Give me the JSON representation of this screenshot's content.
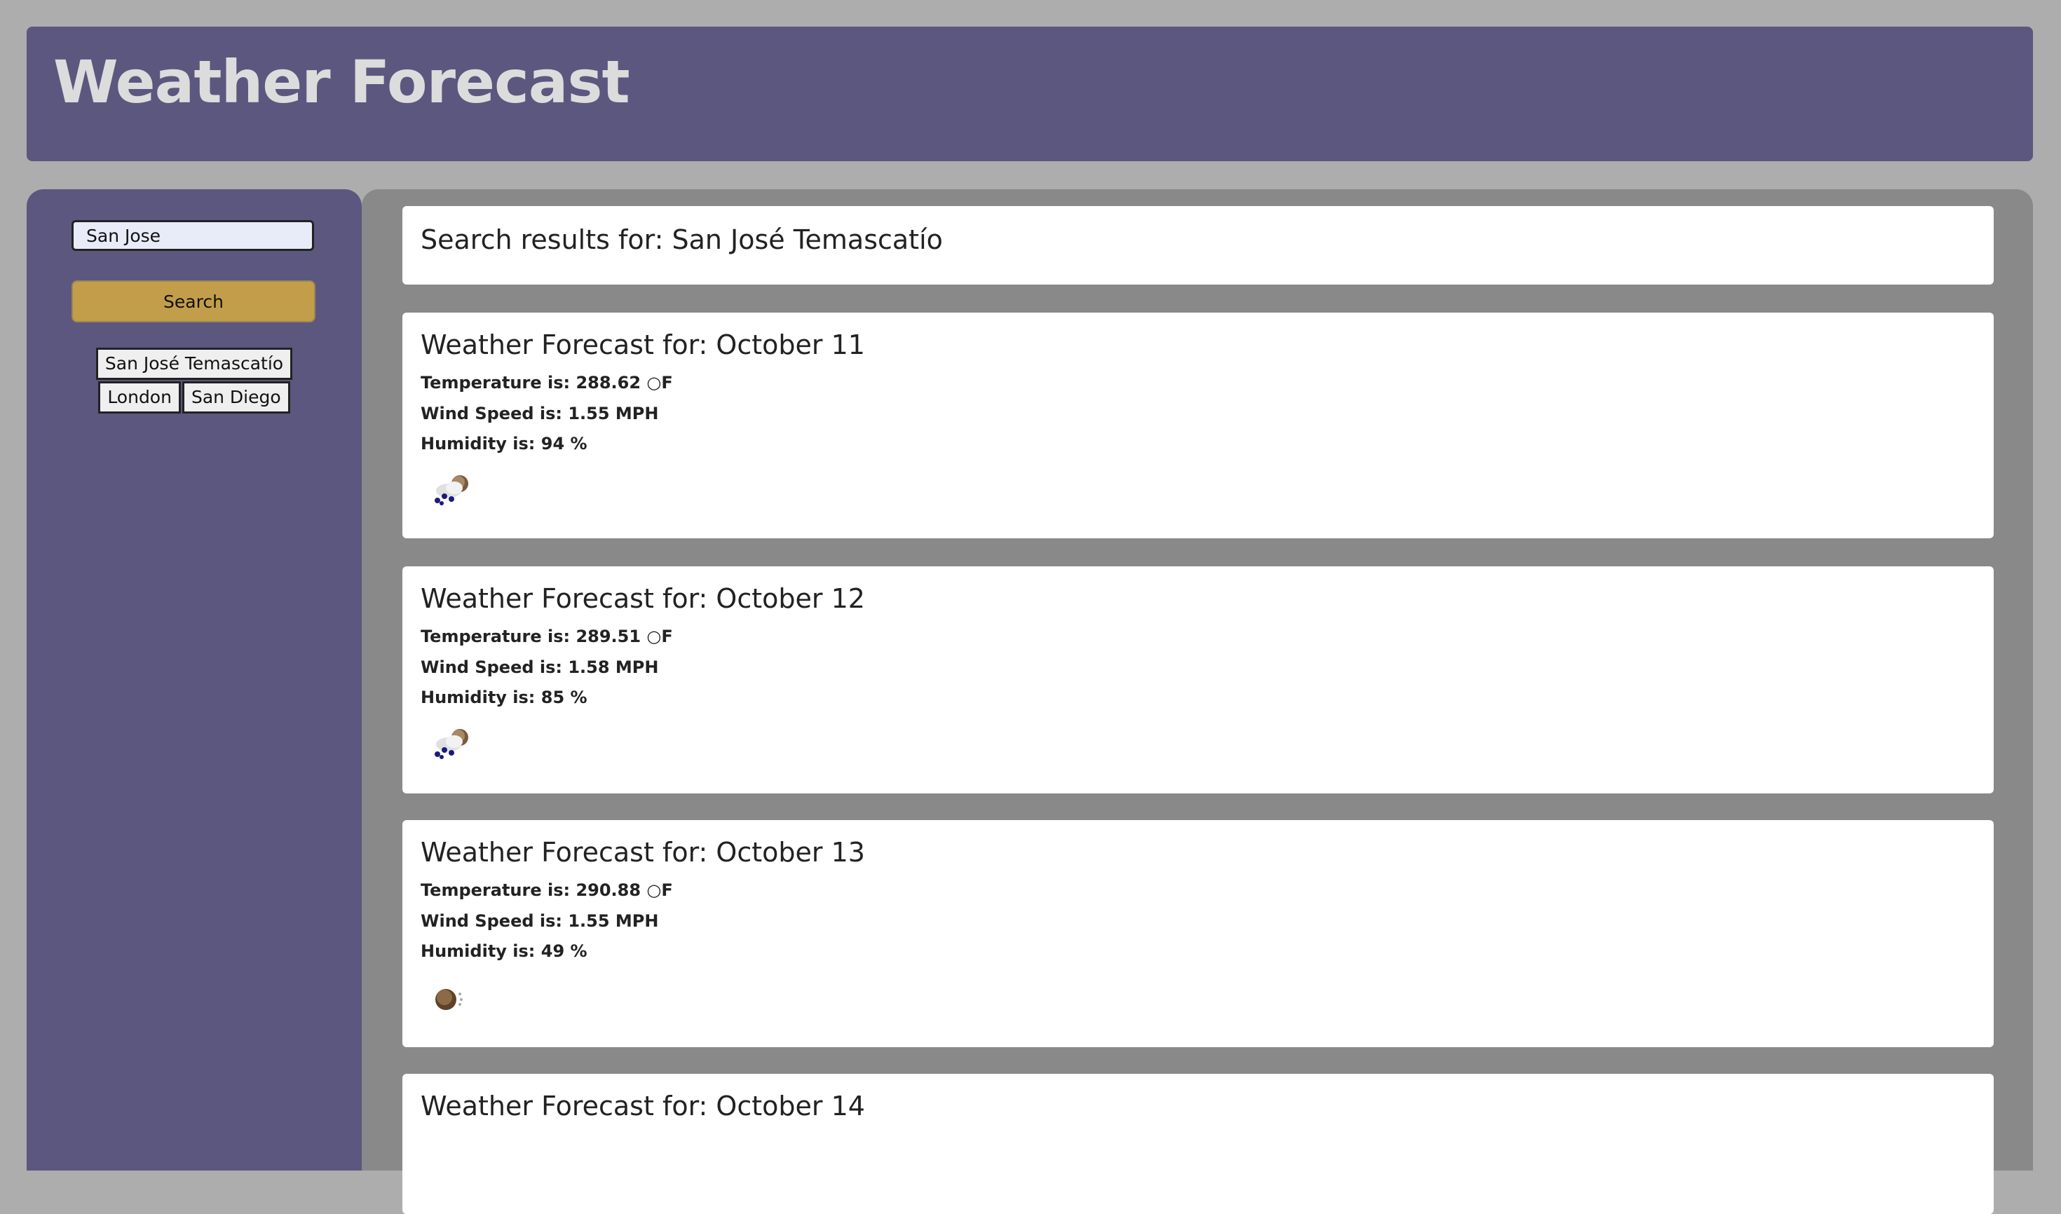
{
  "header": {
    "title": "Weather Forecast"
  },
  "sidebar": {
    "search_value": "San Jose",
    "search_label": "Search",
    "history": [
      "San José Temascatío",
      "London",
      "San Diego"
    ]
  },
  "main": {
    "results_heading": "Search results for: San José Temascatío",
    "forecasts": [
      {
        "title": "Weather Forecast for: October 11",
        "temperature": "Temperature is: 288.62 ○F",
        "wind": "Wind Speed is: 1.55 MPH",
        "humidity": "Humidity is: 94 %",
        "icon": "rain-cloud-icon"
      },
      {
        "title": "Weather Forecast for: October 12",
        "temperature": "Temperature is: 289.51 ○F",
        "wind": "Wind Speed is: 1.58 MPH",
        "humidity": "Humidity is: 85 %",
        "icon": "rain-cloud-icon"
      },
      {
        "title": "Weather Forecast for: October 13",
        "temperature": "Temperature is: 290.88 ○F",
        "wind": "Wind Speed is: 1.55 MPH",
        "humidity": "Humidity is: 49 %",
        "icon": "cloud-icon"
      },
      {
        "title": "Weather Forecast for: October 14"
      }
    ]
  },
  "colors": {
    "page_bg": "#adadad",
    "panel": "#5c577f",
    "main_bg": "#888988",
    "search_button": "#c39e4a"
  }
}
